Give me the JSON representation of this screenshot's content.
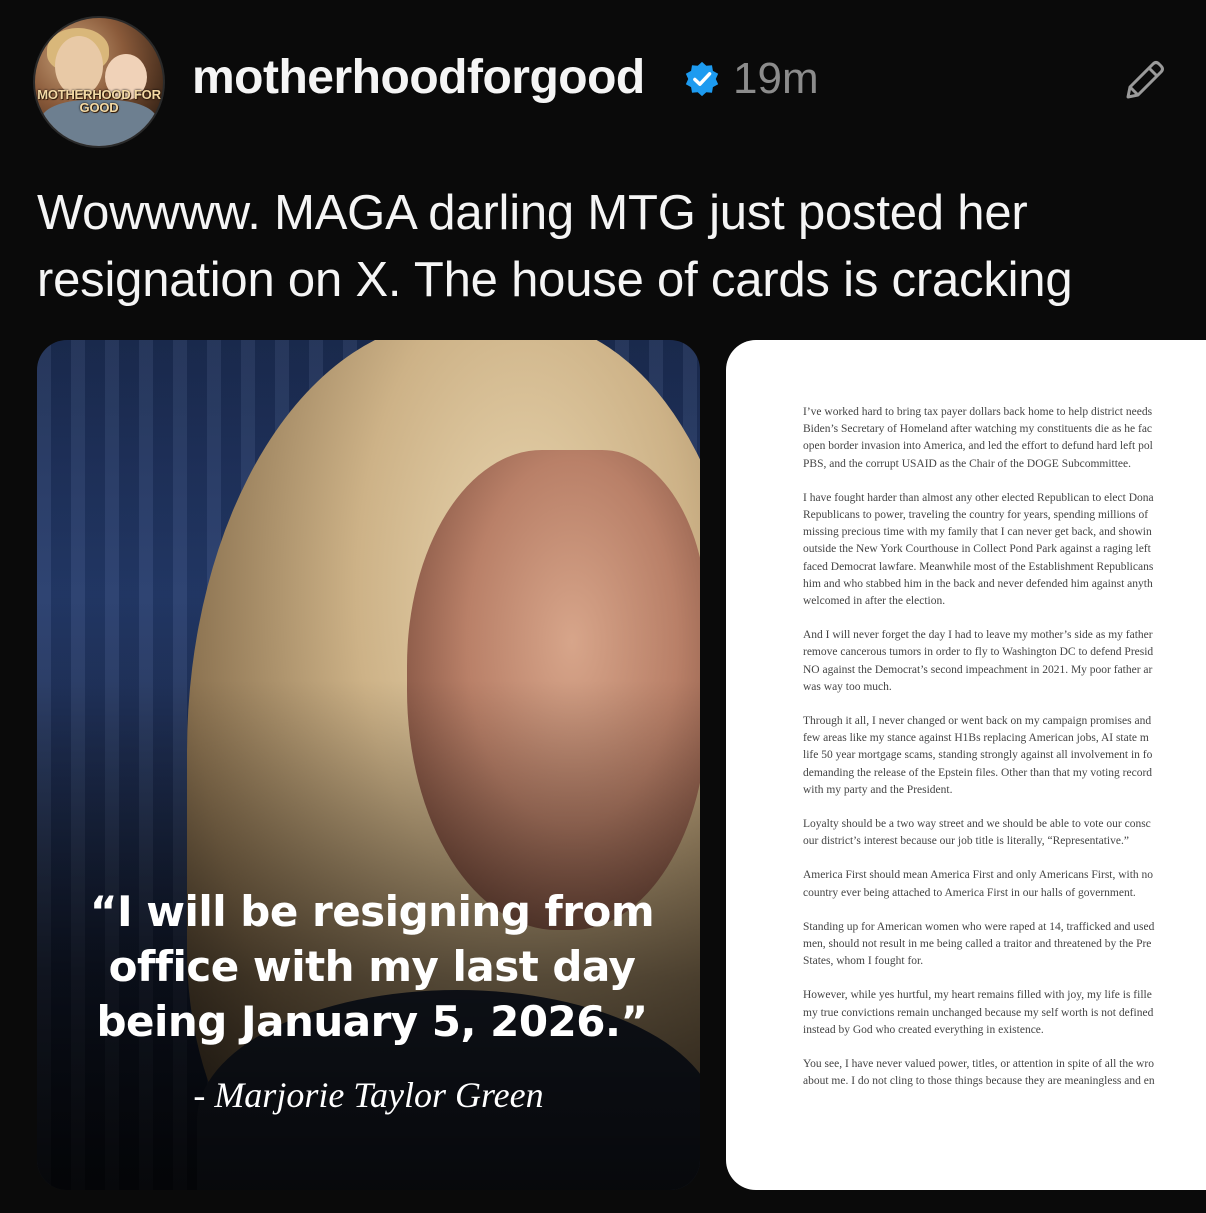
{
  "post": {
    "avatar_text": "MOTHERHOOD FOR GOOD",
    "username": "motherhoodforgood",
    "time": "19m",
    "caption": "Wowwww. MAGA darling MTG just posted her resignation on X. The house of cards is cracking"
  },
  "image_quote": {
    "quote": "“I will be resigning from office with my last day being January 5, 2026.”",
    "attribution": "- Marjorie Taylor Green"
  },
  "letter": {
    "paragraphs": [
      [
        "I’ve worked hard to bring tax payer dollars back home to help district needs",
        "Biden’s Secretary of Homeland after watching my constituents die as he fac",
        "open border invasion into America, and led the effort to defund hard left pol",
        "PBS, and the corrupt USAID as the Chair of the DOGE Subcommittee."
      ],
      [
        "I have fought harder than almost any other elected Republican to elect Dona",
        "Republicans to power, traveling the country for years, spending millions of",
        "missing precious time with my family that I can never get back, and showin",
        "outside the New York Courthouse in Collect Pond Park against a raging left",
        "faced Democrat lawfare. Meanwhile most of the Establishment Republicans",
        "him and who stabbed him in the back and never defended him against anyth",
        "welcomed in after the election."
      ],
      [
        "And I will never forget the day I had to leave my mother’s side as my father",
        "remove cancerous tumors in order to fly to Washington DC to defend Presid",
        "NO against the Democrat’s second impeachment in 2021. My poor father ar",
        "was way too much."
      ],
      [
        "Through it all, I never changed or went back on my campaign promises and",
        "few areas like my stance against H1Bs replacing American jobs, AI state m",
        "life 50 year mortgage scams, standing strongly against all involvement in fo",
        "demanding the release of the Epstein files. Other than that my voting record",
        "with my party and the President."
      ],
      [
        "Loyalty should be a two way street and we should be able to vote our consc",
        "our district’s interest because our job title is literally, “Representative.”"
      ],
      [
        "America First should mean America First and only Americans First, with no",
        "country ever being attached to America First in our halls of government."
      ],
      [
        "Standing up for American women who were raped at 14, trafficked and used",
        "men, should not result in me being called a traitor and threatened by the Pre",
        "States, whom I fought for."
      ],
      [
        "However, while yes hurtful, my heart remains filled with joy, my life is fille",
        "my true convictions remain unchanged because my self worth is not defined",
        "instead by God who created everything in existence."
      ],
      [
        "You see, I have never valued power, titles, or attention in spite of all the wro",
        "about me. I do not cling to those things because they are meaningless and en"
      ]
    ]
  },
  "colors": {
    "background": "#0a0a0a",
    "verified_blue": "#1d9bf0",
    "muted_gray": "#8c8c8c"
  },
  "icons": [
    "verified-badge-icon",
    "edit-pencil-icon"
  ]
}
